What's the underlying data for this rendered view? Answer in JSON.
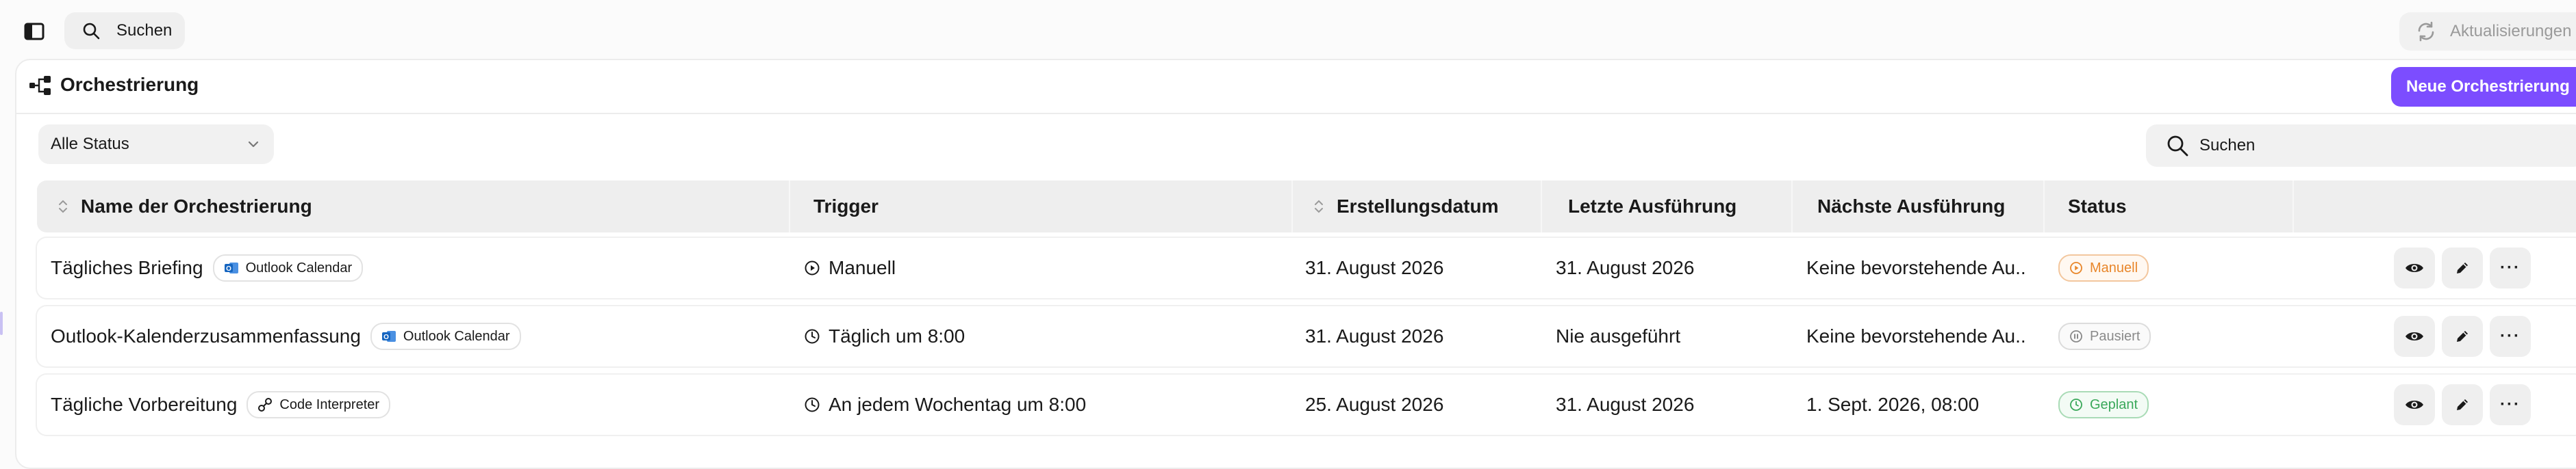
{
  "topbar": {
    "search_label": "Suchen",
    "updates_label": "Aktualisierungen"
  },
  "page": {
    "title": "Orchestrierung",
    "new_button": "Neue Orchestrierung"
  },
  "filters": {
    "status_selected": "Alle Status",
    "search_placeholder": "Suchen"
  },
  "table": {
    "columns": [
      "Name der Orchestrierung",
      "Trigger",
      "Erstellungsdatum",
      "Letzte Ausführung",
      "Nächste Ausführung",
      "Status"
    ],
    "rows": [
      {
        "name": "Tägliches Briefing",
        "integration": "Outlook Calendar",
        "trigger": "Manuell",
        "created": "31. August 2026",
        "last_run": "31. August 2026",
        "next_run": "Keine bevorstehende Au...",
        "status": "Manuell"
      },
      {
        "name": "Outlook-Kalenderzusammenfassung",
        "integration": "Outlook Calendar",
        "trigger": "Täglich um 8:00",
        "created": "31. August 2026",
        "last_run": "Nie ausgeführt",
        "next_run": "Keine bevorstehende Au...",
        "status": "Pausiert"
      },
      {
        "name": "Tägliche Vorbereitung",
        "integration": "Code Interpreter",
        "trigger": "An jedem Wochentag um 8:00",
        "created": "25. August 2026",
        "last_run": "31. August 2026",
        "next_run": "1. Sept. 2026, 08:00",
        "status": "Geplant"
      }
    ]
  },
  "colors": {
    "accent": "#7c4dff",
    "status_manual": "#e8862a",
    "status_paused": "#8a8a8a",
    "status_scheduled": "#3aa85a",
    "outlook_blue": "#1565c0"
  },
  "icons": {
    "sidebar_toggle": "sidebar-toggle-icon",
    "search": "search-icon",
    "refresh": "refresh-icon",
    "orchestration": "workflow-icon",
    "chevron": "chevron-down-icon",
    "sort": "sort-icon",
    "manual_trigger": "play-circle-icon",
    "scheduled_trigger": "clock-icon",
    "outlook": "outlook-icon",
    "code_interpreter": "code-interpreter-icon",
    "view": "eye-icon",
    "edit": "pencil-icon",
    "more": "more-icon"
  }
}
